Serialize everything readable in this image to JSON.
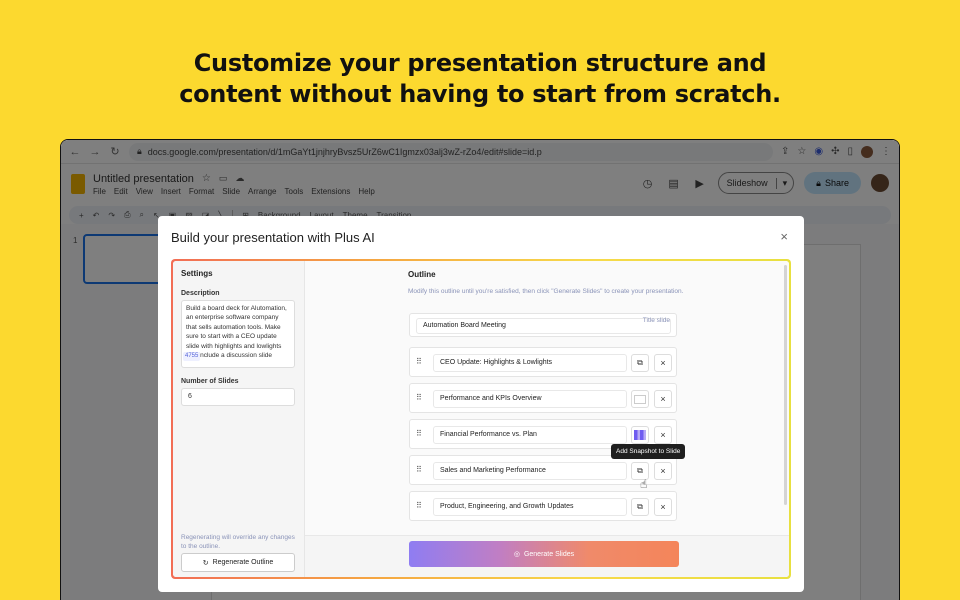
{
  "headline": {
    "line1": "Customize your presentation structure and",
    "line2": "content without having to start from scratch."
  },
  "browser": {
    "url": "docs.google.com/presentation/d/1mGaYt1jnjhryBvsz5UrZ6wC1Igmzx03alj3wZ-rZo4/edit#slide=id.p"
  },
  "docs": {
    "title": "Untitled presentation",
    "menu": [
      "File",
      "Edit",
      "View",
      "Insert",
      "Format",
      "Slide",
      "Arrange",
      "Tools",
      "Extensions",
      "Help"
    ],
    "slideshow_label": "Slideshow",
    "share_label": "Share",
    "toolbar_items": [
      "Background",
      "Layout",
      "Theme",
      "Transition"
    ],
    "thumb_number": "1"
  },
  "modal": {
    "title": "Build your presentation with Plus AI",
    "close": "×",
    "settings": {
      "heading": "Settings",
      "description_label": "Description",
      "description_text": "Build a board deck for Alutomation, an enterprise software company that sells automation tools. Make sure to start with a CEO update slide with highlights and lowlights and include a discussion slide",
      "char_count": "4755",
      "num_slides_label": "Number of Slides",
      "num_slides_value": "6",
      "regen_note": "Regenerating will override any changes to the outline.",
      "regen_button": "Regenerate Outline"
    },
    "outline": {
      "heading": "Outline",
      "subtext": "Modify this outline until you're satisfied, then click \"Generate Slides\" to create your presentation.",
      "title_slide": {
        "text": "Automation Board Meeting",
        "tag": "Title slide"
      },
      "slides": [
        {
          "text": "CEO Update: Highlights & Lowlights"
        },
        {
          "text": "Performance and KPIs Overview"
        },
        {
          "text": "Financial Performance vs. Plan"
        },
        {
          "text": "Sales and Marketing Performance"
        },
        {
          "text": "Product, Engineering, and Growth Updates"
        }
      ],
      "tooltip": "Add Snapshot to Slide",
      "generate_button": "Generate Slides"
    }
  }
}
